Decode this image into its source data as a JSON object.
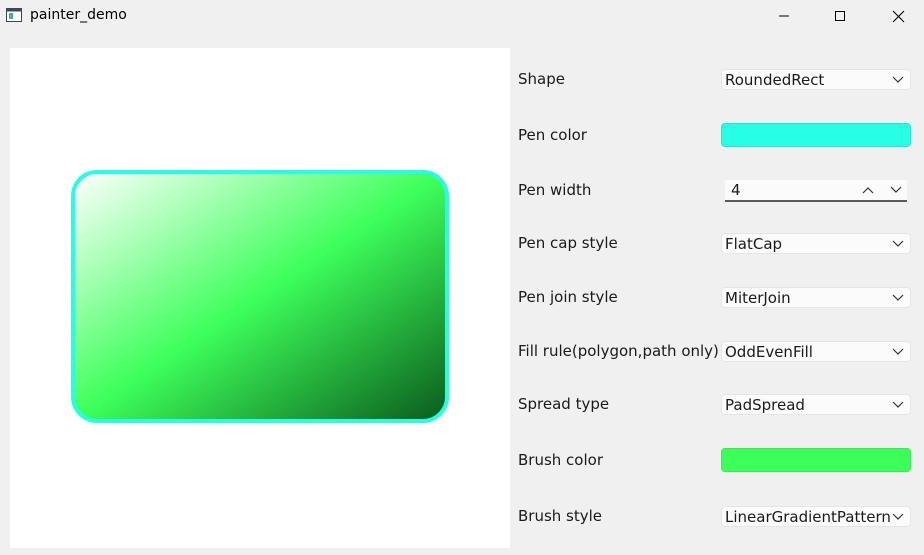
{
  "window": {
    "title": "painter_demo",
    "app_icon": "window-app-icon",
    "controls": [
      "minimize-icon",
      "maximize-icon",
      "close-icon"
    ]
  },
  "canvas": {
    "shape": "RoundedRect",
    "pen_color": "#27ffe4",
    "brush_colors": [
      "#ffffff",
      "#3dff5a",
      "#0a5a1c"
    ]
  },
  "form": {
    "shape": {
      "label": "Shape",
      "value": "RoundedRect"
    },
    "pen_color": {
      "label": "Pen color",
      "color": "#27ffe4"
    },
    "pen_width": {
      "label": "Pen width",
      "value": "4"
    },
    "pen_cap_style": {
      "label": "Pen cap style",
      "value": "FlatCap"
    },
    "pen_join_style": {
      "label": "Pen join style",
      "value": "MiterJoin"
    },
    "fill_rule": {
      "label": "Fill rule(polygon,path only)",
      "value": "OddEvenFill"
    },
    "spread_type": {
      "label": "Spread type",
      "value": "PadSpread"
    },
    "brush_color": {
      "label": "Brush color",
      "color": "#3dff5a"
    },
    "brush_style": {
      "label": "Brush style",
      "value": "LinearGradientPattern"
    }
  }
}
